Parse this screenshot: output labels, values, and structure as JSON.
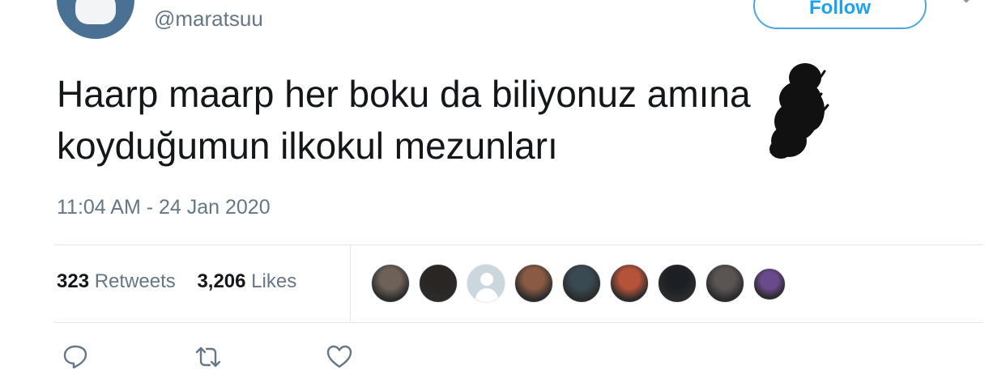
{
  "header": {
    "handle": "@maratsuu",
    "follow_label": "Follow"
  },
  "tweet": {
    "line1": "Haarp maarp her boku da biliyonuz amına",
    "line2": "koyduğumun ilkokul mezunları",
    "timestamp": "11:04 AM - 24 Jan 2020"
  },
  "stats": {
    "retweets_count": "323",
    "retweets_label": "Retweets",
    "likes_count": "3,206",
    "likes_label": "Likes"
  },
  "likers": [
    {
      "color": "#6e6258"
    },
    {
      "color": "#2a2624"
    },
    {
      "color": "#ccd6dd",
      "default": true
    },
    {
      "color": "#8a5a44"
    },
    {
      "color": "#3a4a52"
    },
    {
      "color": "#b5523a"
    },
    {
      "color": "#1c1f24"
    },
    {
      "color": "#5a5452"
    },
    {
      "color": "#6a4a8c"
    }
  ],
  "actions": {
    "reply_icon": "reply-icon",
    "retweet_icon": "retweet-icon",
    "like_icon": "heart-icon"
  },
  "colors": {
    "accent": "#1da1f2",
    "muted_text": "#657786",
    "divider": "#e1e8ed"
  }
}
